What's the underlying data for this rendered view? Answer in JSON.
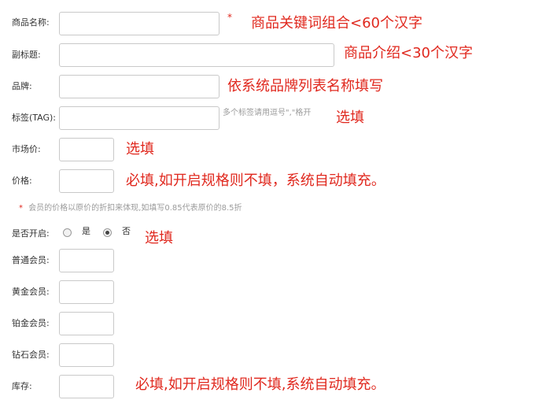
{
  "form": {
    "product_name": {
      "label": "商品名称:",
      "value": "",
      "required_mark": "*",
      "note": "商品关键词组合<60个汉字"
    },
    "subtitle": {
      "label": "副标题:",
      "value": "",
      "note": "商品介绍<30个汉字"
    },
    "brand": {
      "label": "品牌:",
      "value": "",
      "note": "依系统品牌列表名称填写"
    },
    "tags": {
      "label": "标签(TAG):",
      "value": "",
      "hint": "多个标签请用逗号\",\"格开",
      "note": "选填"
    },
    "market_price": {
      "label": "市场价:",
      "value": "",
      "note": "选填"
    },
    "price": {
      "label": "价格:",
      "value": "",
      "note": "必填,如开启规格则不填，系统自动填充。"
    },
    "member_price_hint": {
      "star": "*",
      "text": "会员的价格以原价的折扣来体现,如填写0.85代表原价的8.5折"
    },
    "enable": {
      "label": "是否开启:",
      "options": [
        {
          "label": "是",
          "checked": false
        },
        {
          "label": "否",
          "checked": true
        }
      ],
      "note": "选填"
    },
    "member_levels": [
      {
        "label": "普通会员:",
        "value": ""
      },
      {
        "label": "黄金会员:",
        "value": ""
      },
      {
        "label": "铂金会员:",
        "value": ""
      },
      {
        "label": "钻石会员:",
        "value": ""
      }
    ],
    "stock": {
      "label": "库存:",
      "value": "",
      "note": "必填,如开启规格则不填,系统自动填充。"
    }
  },
  "colors": {
    "annotation": "#e0281e",
    "hint": "#9b9b9b",
    "border": "#c9c9c9"
  }
}
